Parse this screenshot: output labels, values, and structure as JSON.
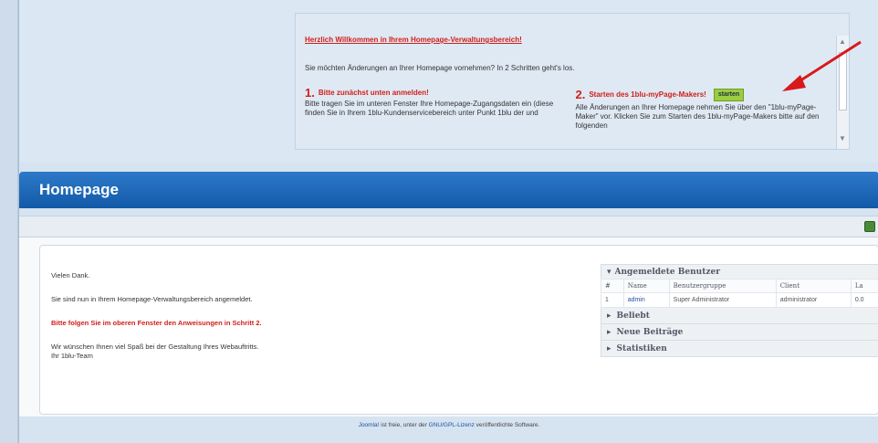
{
  "welcome": {
    "title": "Herzlich Willkommen in Ihrem Homepage-Verwaltungsbereich!",
    "subtitle": "Sie möchten Änderungen an Ihrer Homepage vornehmen? In 2 Schritten geht's los.",
    "step1": {
      "number": "1.",
      "label": "Bitte zunächst unten anmelden!",
      "text": "Bitte tragen Sie im unteren Fenster Ihre Homepage-Zugangsdaten ein (diese finden Sie in Ihrem 1blu-Kundenservicebereich unter Punkt 1blu der und"
    },
    "step2": {
      "number": "2.",
      "label": "Starten des 1blu-myPage-Makers!",
      "button": "starten",
      "text": "Alle Änderungen an Ihrer Homepage nehmen Sie über den \"1blu-myPage-Maker\" vor. Klicken Sie zum Starten des 1blu-myPage-Makers bitte auf den folgenden"
    }
  },
  "header": {
    "title": "Homepage"
  },
  "main": {
    "line1": "Vielen Dank.",
    "line2": "Sie sind nun in Ihrem Homepage-Verwaltungsbereich angemeldet.",
    "line3": "Bitte folgen Sie im oberen Fenster den Anweisungen in Schritt 2.",
    "line4": "Wir wünschen Ihnen viel Spaß bei der Gestaltung Ihres Webauftritts.",
    "line5": "Ihr 1blu-Team"
  },
  "modules": {
    "logged_in": {
      "title": "Angemeldete Benutzer",
      "columns": [
        "#",
        "Name",
        "Benutzergruppe",
        "Client",
        "La"
      ],
      "rows": [
        [
          "1",
          "admin",
          "Super Administrator",
          "administrator",
          "0.0"
        ]
      ]
    },
    "popular": "Beliebt",
    "new_posts": "Neue Beiträge",
    "stats": "Statistiken"
  },
  "footer": {
    "joomla": "Joomla!",
    "text1": " ist freie, unter der ",
    "license": "GNU/GPL-Lizenz",
    "text2": " veröffentlichte Software."
  }
}
